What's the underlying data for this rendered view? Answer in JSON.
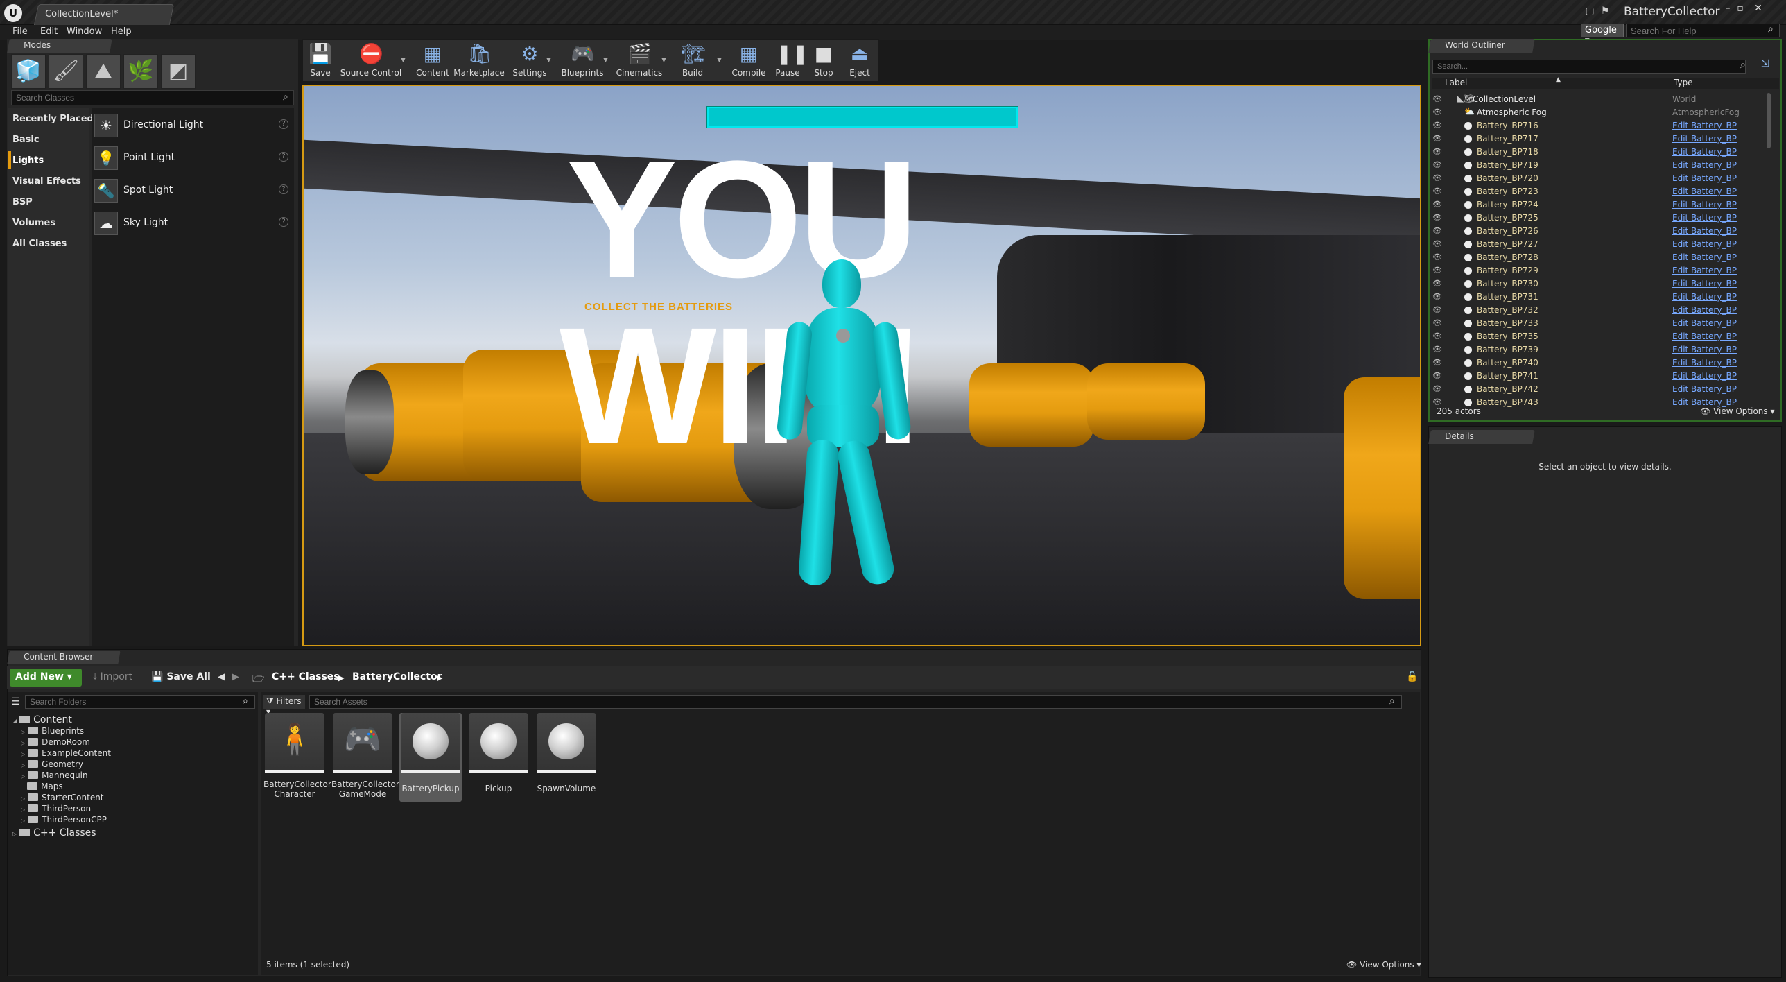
{
  "title_bar": {
    "doc_tab": "CollectionLevel*",
    "project_name": "BatteryCollector"
  },
  "menu": [
    "File",
    "Edit",
    "Window",
    "Help"
  ],
  "help_search": {
    "engine": "Google ▾",
    "placeholder": "Search For Help"
  },
  "modes": {
    "tab_label": "Modes",
    "search_placeholder": "Search Classes",
    "categories": [
      "Recently Placed",
      "Basic",
      "Lights",
      "Visual Effects",
      "BSP",
      "Volumes",
      "All Classes"
    ],
    "selected_category": "Lights",
    "items": [
      "Directional Light",
      "Point Light",
      "Spot Light",
      "Sky Light"
    ]
  },
  "toolbar": {
    "buttons": [
      "Save",
      "Source Control",
      "Content",
      "Marketplace",
      "Settings",
      "Blueprints",
      "Cinematics",
      "Build",
      "Compile",
      "Pause",
      "Stop",
      "Eject"
    ]
  },
  "viewport": {
    "banner": "YOU WIN!",
    "caption": "COLLECT THE BATTERIES",
    "accent": "#d59a13",
    "health_bar_color": "#00c8cc"
  },
  "world_outliner": {
    "tab_label": "World Outliner",
    "search_placeholder": "Search...",
    "col_label": "Label",
    "col_type": "Type",
    "rows": [
      {
        "label": "CollectionLevel",
        "type": "World"
      },
      {
        "label": "Atmospheric Fog",
        "type": "AtmosphericFog"
      },
      {
        "label": "Battery_BP716",
        "type": "Edit Battery_BP"
      },
      {
        "label": "Battery_BP717",
        "type": "Edit Battery_BP"
      },
      {
        "label": "Battery_BP718",
        "type": "Edit Battery_BP"
      },
      {
        "label": "Battery_BP719",
        "type": "Edit Battery_BP"
      },
      {
        "label": "Battery_BP720",
        "type": "Edit Battery_BP"
      },
      {
        "label": "Battery_BP723",
        "type": "Edit Battery_BP"
      },
      {
        "label": "Battery_BP724",
        "type": "Edit Battery_BP"
      },
      {
        "label": "Battery_BP725",
        "type": "Edit Battery_BP"
      },
      {
        "label": "Battery_BP726",
        "type": "Edit Battery_BP"
      },
      {
        "label": "Battery_BP727",
        "type": "Edit Battery_BP"
      },
      {
        "label": "Battery_BP728",
        "type": "Edit Battery_BP"
      },
      {
        "label": "Battery_BP729",
        "type": "Edit Battery_BP"
      },
      {
        "label": "Battery_BP730",
        "type": "Edit Battery_BP"
      },
      {
        "label": "Battery_BP731",
        "type": "Edit Battery_BP"
      },
      {
        "label": "Battery_BP732",
        "type": "Edit Battery_BP"
      },
      {
        "label": "Battery_BP733",
        "type": "Edit Battery_BP"
      },
      {
        "label": "Battery_BP735",
        "type": "Edit Battery_BP"
      },
      {
        "label": "Battery_BP739",
        "type": "Edit Battery_BP"
      },
      {
        "label": "Battery_BP740",
        "type": "Edit Battery_BP"
      },
      {
        "label": "Battery_BP741",
        "type": "Edit Battery_BP"
      },
      {
        "label": "Battery_BP742",
        "type": "Edit Battery_BP"
      },
      {
        "label": "Battery_BP743",
        "type": "Edit Battery_BP"
      }
    ],
    "actor_count": "205 actors",
    "view_options": "View Options ▾"
  },
  "details": {
    "tab_label": "Details",
    "empty_message": "Select an object to view details."
  },
  "content_browser": {
    "tab_label": "Content Browser",
    "add_new": "Add New ▾",
    "import": "Import",
    "save_all": "Save All",
    "path": [
      "C++ Classes",
      "BatteryCollector"
    ],
    "folder_search_placeholder": "Search Folders",
    "asset_search_placeholder": "Search Assets",
    "filters": "Filters ▾",
    "folders": [
      {
        "name": "Content",
        "level": 0,
        "expanded": true
      },
      {
        "name": "Blueprints",
        "level": 1
      },
      {
        "name": "DemoRoom",
        "level": 1
      },
      {
        "name": "ExampleContent",
        "level": 1
      },
      {
        "name": "Geometry",
        "level": 1
      },
      {
        "name": "Mannequin",
        "level": 1
      },
      {
        "name": "Maps",
        "level": 1
      },
      {
        "name": "StarterContent",
        "level": 1
      },
      {
        "name": "ThirdPerson",
        "level": 1
      },
      {
        "name": "ThirdPersonCPP",
        "level": 1
      },
      {
        "name": "C++ Classes",
        "level": 0
      }
    ],
    "assets": [
      {
        "line1": "BatteryCollector",
        "line2": "Character",
        "kind": "mannequin"
      },
      {
        "line1": "BatteryCollector",
        "line2": "GameMode",
        "kind": "gamepad"
      },
      {
        "line1": "BatteryPickup",
        "line2": "",
        "kind": "sphere",
        "selected": true
      },
      {
        "line1": "Pickup",
        "line2": "",
        "kind": "sphere"
      },
      {
        "line1": "SpawnVolume",
        "line2": "",
        "kind": "sphere"
      }
    ],
    "status": "5 items (1 selected)",
    "view_options": "View Options ▾"
  }
}
